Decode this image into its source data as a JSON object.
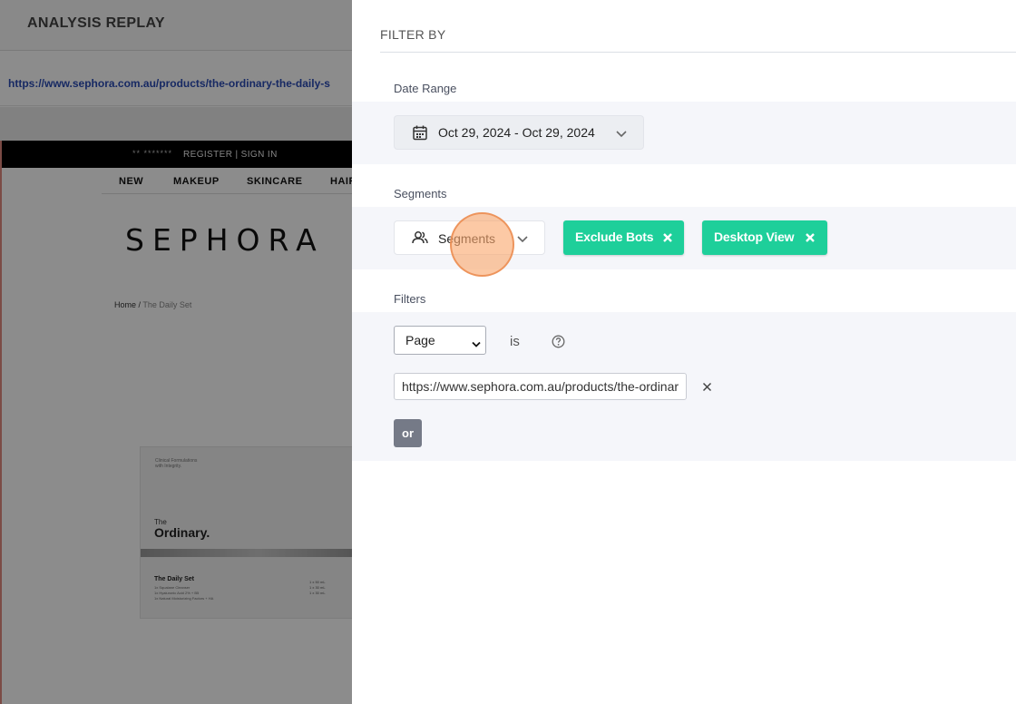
{
  "app": {
    "title": "ANALYSIS REPLAY",
    "url": "https://www.sephora.com.au/products/the-ordinary-the-daily-s"
  },
  "site": {
    "topbar_stars": "** *******",
    "topbar_auth": "REGISTER | SIGN IN",
    "nav": [
      "NEW",
      "MAKEUP",
      "SKINCARE",
      "HAIR"
    ],
    "logo": "SEPHORA",
    "breadcrumb_home": "Home",
    "breadcrumb_sep": " / ",
    "breadcrumb_current": "The Daily Set",
    "product": {
      "tagline_1": "Clinical Formulations",
      "tagline_2": "with Integrity.",
      "brand_prefix": "The",
      "brand": "Ordinary.",
      "set_name": "The Daily Set",
      "line_1": "1x Squalane Cleanser",
      "line_2": "1x Hyaluronic Acid 2% + B5",
      "line_3": "1x Natural Moisturizing Factors + HA",
      "size_1": "1 x 50 mL",
      "size_2": "1 x 30 mL",
      "size_3": "1 x 30 mL"
    }
  },
  "filter": {
    "title": "FILTER BY",
    "date_range": {
      "label": "Date Range",
      "value": "Oct 29, 2024 - Oct 29, 2024"
    },
    "segments": {
      "label": "Segments",
      "button_label": "Segments",
      "chips": [
        {
          "label": "Exclude Bots"
        },
        {
          "label": "Desktop View"
        }
      ]
    },
    "filters": {
      "label": "Filters",
      "field_select": "Page",
      "operator": "is",
      "value_input": "https://www.sephora.com.au/products/the-ordinary-the-daily-set",
      "or_button": "or"
    }
  },
  "colors": {
    "chip_green": "#1ecf9a",
    "click_indicator": "#faa86e",
    "link_blue": "#2a4bb5",
    "or_button_gray": "#757a87"
  },
  "icons": [
    "calendar-icon",
    "chevron-down-icon",
    "people-icon",
    "close-icon",
    "help-circle-icon"
  ]
}
